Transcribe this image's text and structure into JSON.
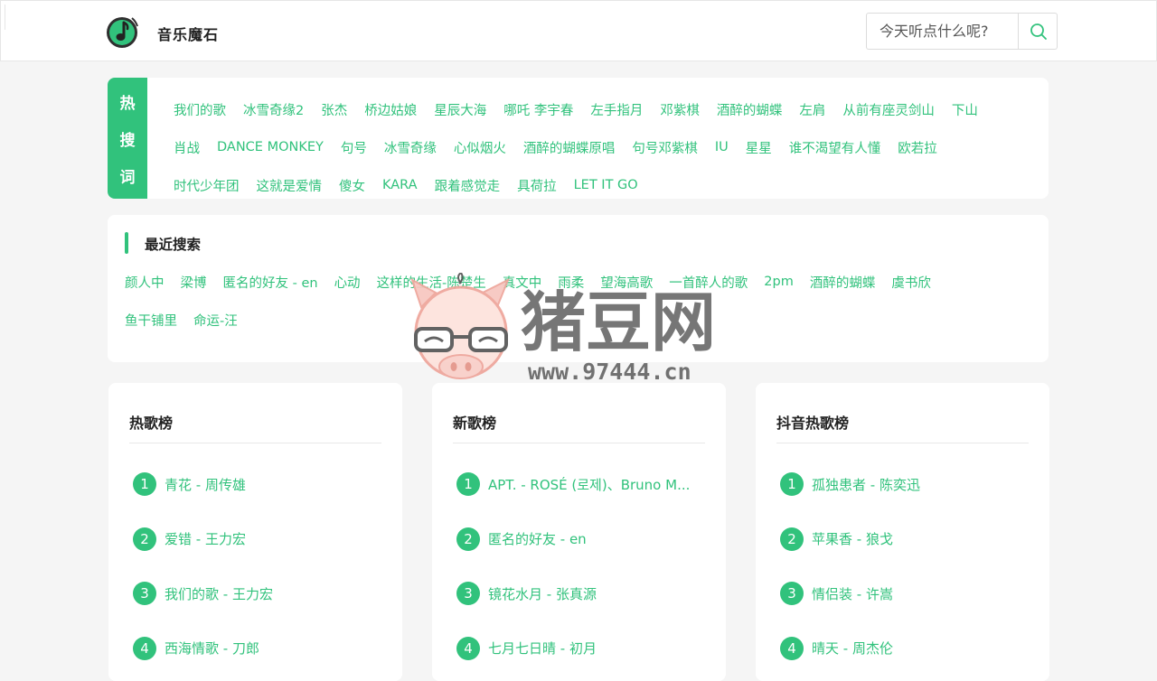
{
  "header": {
    "brand": "音乐魔石",
    "search_placeholder": "今天听点什么呢?"
  },
  "hot": {
    "tag_chars": [
      "热",
      "搜",
      "词"
    ],
    "rows": [
      [
        "我们的歌",
        "冰雪奇缘2",
        "张杰",
        "桥边姑娘",
        "星辰大海",
        "哪吒 李宇春",
        "左手指月",
        "邓紫棋",
        "酒醉的蝴蝶",
        "左肩",
        "从前有座灵剑山",
        "下山"
      ],
      [
        "肖战",
        "DANCE MONKEY",
        "句号",
        "冰雪奇缘",
        "心似烟火",
        "酒醉的蝴蝶原唱",
        "句号邓紫棋",
        "IU",
        "星星",
        "谁不渴望有人懂",
        "欧若拉"
      ],
      [
        "时代少年团",
        "这就是爱情",
        "傻女",
        "KARA",
        "跟着感觉走",
        "具荷拉",
        "LET IT GO"
      ]
    ]
  },
  "recent": {
    "title": "最近搜索",
    "rows": [
      [
        "颜人中",
        "梁博",
        "匿名的好友 - en",
        "心动",
        "这样的生活-陈楚生",
        "真文中",
        "雨柔",
        "望海高歌",
        "一首醉人的歌",
        "2pm",
        "酒醉的蝴蝶",
        "虞书欣"
      ],
      [
        "鱼干铺里",
        "命运-汪"
      ]
    ]
  },
  "charts": [
    {
      "title": "热歌榜",
      "items": [
        {
          "rank": "1",
          "text": "青花 - 周传雄"
        },
        {
          "rank": "2",
          "text": "爱错 - 王力宏"
        },
        {
          "rank": "3",
          "text": "我们的歌 - 王力宏"
        },
        {
          "rank": "4",
          "text": "西海情歌 - 刀郎"
        }
      ]
    },
    {
      "title": "新歌榜",
      "items": [
        {
          "rank": "1",
          "text": "APT. - ROSÉ (로제)、Bruno M..."
        },
        {
          "rank": "2",
          "text": "匿名的好友 - en"
        },
        {
          "rank": "3",
          "text": "镜花水月 - 张真源"
        },
        {
          "rank": "4",
          "text": "七月七日晴 - 初月"
        }
      ]
    },
    {
      "title": "抖音热歌榜",
      "items": [
        {
          "rank": "1",
          "text": "孤独患者 - 陈奕迅"
        },
        {
          "rank": "2",
          "text": "苹果香 - 狼戈"
        },
        {
          "rank": "3",
          "text": "情侣装 - 许嵩"
        },
        {
          "rank": "4",
          "text": "晴天 - 周杰伦"
        }
      ]
    }
  ],
  "watermark": {
    "name": "猪豆网",
    "url": "www.97444.cn"
  },
  "colors": {
    "accent": "#31c27c",
    "page_bg": "#f5f5f5",
    "card_bg": "#ffffff"
  }
}
